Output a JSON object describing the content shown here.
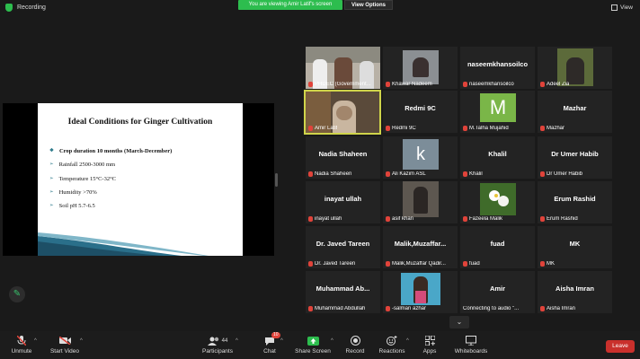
{
  "topbar": {
    "recording_label": "Recording",
    "viewing_banner": "You are viewing Amir Latif's screen",
    "view_options_label": "View Options",
    "view_label": "View"
  },
  "slide": {
    "title": "Ideal Conditions for Ginger Cultivation",
    "bullets": [
      "Crop duration 10 months (March-December)",
      "Rainfall 2500-3000 mm",
      "Temperature 15°C-32°C",
      "Humidity >70%",
      "Soil pH 5.7-6.5"
    ]
  },
  "participants": {
    "tiles": [
      {
        "name": "",
        "label": "PHDEC (Government..."
      },
      {
        "name": "",
        "label": "Khawar Nadeem"
      },
      {
        "name": "naseemkhansoilco",
        "label": "naseemkhansoilco"
      },
      {
        "name": "",
        "label": "Adeel Zia"
      },
      {
        "name": "",
        "label": "Amir Latif"
      },
      {
        "name": "Redmi 9C",
        "label": "Redmi 9C"
      },
      {
        "name": "",
        "label": "M.Talha Mujahid"
      },
      {
        "name": "Mazhar",
        "label": "Mazhar"
      },
      {
        "name": "Nadia Shaheen",
        "label": "Nadia Shaheen"
      },
      {
        "name": "",
        "label": "Ali Kazim ASL"
      },
      {
        "name": "Khalil",
        "label": "Khalil"
      },
      {
        "name": "Dr Umer Habib",
        "label": "Dr Umer Habib"
      },
      {
        "name": "inayat ullah",
        "label": "inayat ullah"
      },
      {
        "name": "",
        "label": "asif khan"
      },
      {
        "name": "",
        "label": "Fazeela Malik"
      },
      {
        "name": "Erum Rashid",
        "label": "Erum Rashid"
      },
      {
        "name": "Dr. Javed Tareen",
        "label": "Dr. Javed Tareen"
      },
      {
        "name": "Malik,Muzaffar...",
        "label": "Malik,Muzaffar Qadir..."
      },
      {
        "name": "fuad",
        "label": "fuad"
      },
      {
        "name": "MK",
        "label": "MK"
      },
      {
        "name": "Muhammad Ab...",
        "label": "Muhammad Abdullah"
      },
      {
        "name": "",
        "label": "-salman azhar"
      },
      {
        "name": "Amir",
        "label": "Connecting to audio \"..."
      },
      {
        "name": "Aisha Imran",
        "label": "Aisha Imran"
      }
    ],
    "avatar_letters": {
      "talha": "M",
      "ali": "k"
    }
  },
  "toolbar": {
    "unmute": "Unmute",
    "start_video": "Start Video",
    "participants": "Participants",
    "participants_count": "44",
    "chat": "Chat",
    "chat_badge": "10",
    "share_screen": "Share Screen",
    "record": "Record",
    "reactions": "Reactions",
    "apps": "Apps",
    "whiteboards": "Whiteboards",
    "leave": "Leave"
  },
  "colors": {
    "accent_green": "#2dbd4e",
    "leave_red": "#c9302c",
    "active_speaker": "#cfd44a",
    "muted_red": "#e0433a"
  }
}
